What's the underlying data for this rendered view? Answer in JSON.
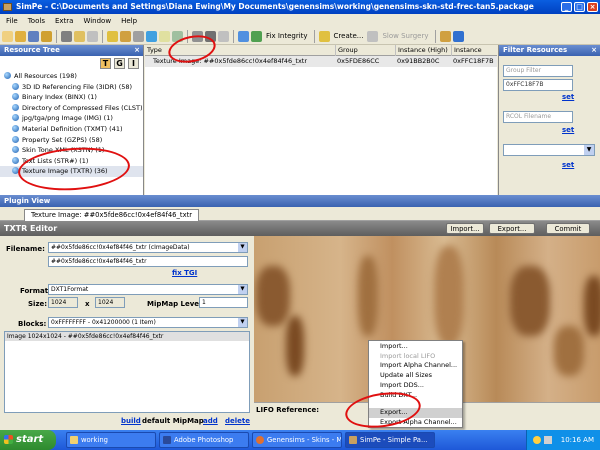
{
  "window": {
    "title": "SimPe - C:\\Documents and Settings\\Diana Ewing\\My Documents\\genensims\\working\\genensims-skn-std-frec-tan5.package"
  },
  "menu": [
    "File",
    "Tools",
    "Extra",
    "Window",
    "Help"
  ],
  "toolbar": {
    "fix_integrity": "Fix Integrity",
    "create": "Create...",
    "slow_surgery": "Slow Surgery"
  },
  "resource_tree": {
    "title": "Resource Tree",
    "buttons": [
      "T",
      "G",
      "I"
    ],
    "items": [
      {
        "label": "All Resources (198)"
      },
      {
        "label": "3D ID Referencing File (3IDR) (58)"
      },
      {
        "label": "Binary Index (BINX) (1)"
      },
      {
        "label": "Directory of Compressed Files (CLST)"
      },
      {
        "label": "jpg/tga/png Image (IMG) (1)"
      },
      {
        "label": "Material Definition (TXMT) (41)"
      },
      {
        "label": "Property Set (GZPS) (58)"
      },
      {
        "label": "Skin Tone XML (XSTN) (1)"
      },
      {
        "label": "Text Lists (STR#) (1)"
      },
      {
        "label": "Texture Image (TXTR) (36)"
      }
    ]
  },
  "resource_list": {
    "columns": [
      "Type",
      "Group",
      "Instance (High)",
      "Instance"
    ],
    "rows": [
      {
        "type": "Texture Image: ##0x5fde86cc!0x4ef84f46_txtr",
        "group": "0x5FDE86CC",
        "instance_high": "0x91BB2B0C",
        "instance": "0xFFC18F7B"
      }
    ]
  },
  "filter": {
    "title": "Filter Resources",
    "group_placeholder": "Group Filter",
    "group_value": "0xFFC18F7B",
    "set_label": "set",
    "rcol_placeholder": "RCOL Filename",
    "set2_label": "set",
    "set3_label": "set"
  },
  "plugin_view": {
    "title": "Plugin View",
    "tab": "Texture Image: ##0x5fde86cc!0x4ef84f46_txtr"
  },
  "txtr_editor": {
    "title": "TXTR Editor",
    "import_btn": "Import...",
    "export_btn": "Export...",
    "commit_btn": "Commit",
    "filename_label": "Filename:",
    "filename_value": "##0x5fde86cc!0x4ef84f46_txtr (cImageData)",
    "filename_value2": "##0x5fde86cc!0x4ef84f46_txtr",
    "fix_tgi": "fix TGI",
    "format_label": "Format:",
    "format_value": "DXT1Format",
    "size_label": "Size:",
    "size_w": "1024",
    "size_x": "x",
    "size_h": "1024",
    "mipmap_label": "MipMap Level:",
    "mipmap_value": "1",
    "blocks_label": "Blocks:",
    "blocks_value": "0xFFFFFFFF - 0x41200000 (1 Item)",
    "image_item": "Image 1024x1024 - ##0x5fde86cc!0x4ef84f46_txtr",
    "build_link": "build",
    "default_mipmap": "default MipMap",
    "add_link": "add",
    "delete_link": "delete",
    "lifo_label": "LIFO Reference:"
  },
  "context_menu": {
    "items": [
      {
        "label": "Import...",
        "disabled": false
      },
      {
        "label": "Import local LIFO",
        "disabled": true
      },
      {
        "label": "Import Alpha Channel...",
        "disabled": false
      },
      {
        "label": "Update all Sizes",
        "disabled": false
      },
      {
        "label": "Import DDS...",
        "disabled": false
      },
      {
        "label": "Build DXT...",
        "disabled": false
      },
      {
        "label": "",
        "disabled": false
      },
      {
        "label": "Export...",
        "disabled": false,
        "highlight": true
      },
      {
        "label": "Export Alpha Channel...",
        "disabled": false
      }
    ]
  },
  "taskbar": {
    "start": "start",
    "tasks": [
      "working",
      "Adobe Photoshop",
      "Genensims - Skins - M...",
      "SimPe - Simple Pa..."
    ],
    "clock": "10:16 AM"
  },
  "colors": {
    "title_bar": "#0a5ee0",
    "panel_header": "#3a62b0",
    "txtr_header": "#5e5e5e",
    "annotation": "#e01010",
    "link": "#0033cc"
  }
}
